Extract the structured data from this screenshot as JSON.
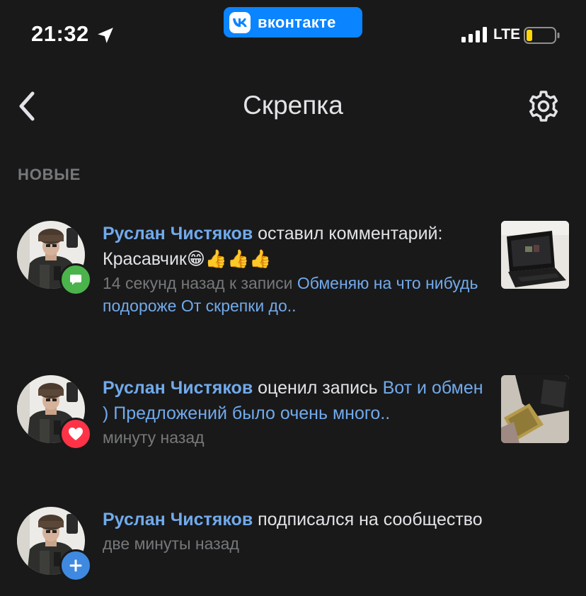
{
  "status_bar": {
    "time": "21:32",
    "network": "LTE",
    "battery_color": "#ffd60a"
  },
  "app_badge": {
    "name": "вконтакте",
    "color": "#0a84ff"
  },
  "header": {
    "title": "Скрепка",
    "back_icon": "chevron-left-icon",
    "settings_icon": "gear-icon"
  },
  "section": {
    "title": "НОВЫЕ"
  },
  "notifications": [
    {
      "user": "Руслан Чистяков",
      "action": " оставил комментарий:",
      "comment": "Красавчик😁👍👍👍",
      "time": "14 секунд назад к записи ",
      "post_link": "Обменяю на что нибудь подороже От скрепки до..",
      "badge_icon": "comment-icon",
      "badge_color": "#4bb34b",
      "thumb": "laptop-photo"
    },
    {
      "user": "Руслан Чистяков",
      "action": " оценил запись ",
      "post_link": "Вот и обмен ) Предложений было очень много..",
      "time": "минуту назад",
      "badge_icon": "heart-icon",
      "badge_color": "#ff3347",
      "thumb": "money-photo"
    },
    {
      "user": "Руслан Чистяков",
      "action": " подписался на сообщество",
      "time": "две минуты назад",
      "badge_icon": "plus-icon",
      "badge_color": "#3f8ae0"
    }
  ],
  "colors": {
    "background": "#19191a",
    "link": "#71aaeb",
    "secondary_text": "#76787a",
    "primary_text": "#e1e3e6"
  }
}
